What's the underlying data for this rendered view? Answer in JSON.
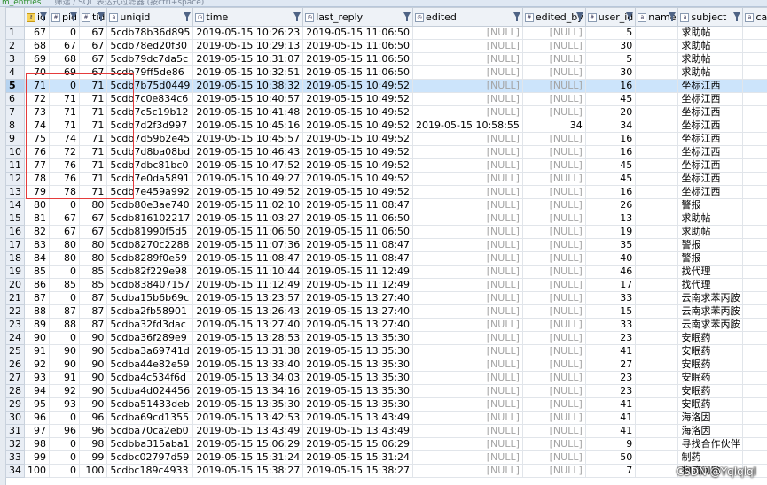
{
  "window": {
    "tab_label": "m_entries",
    "hint": "筛选 / SQL 表达式过滤器 (按ctrl+space)"
  },
  "columns": [
    {
      "label": "id",
      "icon": "key-icon"
    },
    {
      "label": "pid",
      "icon": "number-icon"
    },
    {
      "label": "tid",
      "icon": "number-icon"
    },
    {
      "label": "uniqid",
      "icon": "text-icon"
    },
    {
      "label": "time",
      "icon": "clock-icon"
    },
    {
      "label": "last_reply",
      "icon": "clock-icon"
    },
    {
      "label": "edited",
      "icon": "clock-icon"
    },
    {
      "label": "edited_by",
      "icon": "number-icon"
    },
    {
      "label": "user_id",
      "icon": "number-icon"
    },
    {
      "label": "name",
      "icon": "text-icon"
    },
    {
      "label": "subject",
      "icon": "text-icon"
    },
    {
      "label": "category",
      "icon": "text-icon"
    }
  ],
  "rows": [
    {
      "n": "1",
      "id": "67",
      "pid": "0",
      "tid": "67",
      "uniqid": "5cdb78b36d895",
      "time": "2019-05-15 10:26:23",
      "last_reply": "2019-05-15 11:06:50",
      "edited": "[NULL]",
      "edited_by": "[NULL]",
      "user_id": "5",
      "subject": "求助帖"
    },
    {
      "n": "2",
      "id": "68",
      "pid": "67",
      "tid": "67",
      "uniqid": "5cdb78ed20f30",
      "time": "2019-05-15 10:29:13",
      "last_reply": "2019-05-15 11:06:50",
      "edited": "[NULL]",
      "edited_by": "[NULL]",
      "user_id": "30",
      "subject": "求助帖"
    },
    {
      "n": "3",
      "id": "69",
      "pid": "68",
      "tid": "67",
      "uniqid": "5cdb79dc7da5c",
      "time": "2019-05-15 10:31:07",
      "last_reply": "2019-05-15 11:06:50",
      "edited": "[NULL]",
      "edited_by": "[NULL]",
      "user_id": "5",
      "subject": "求助帖"
    },
    {
      "n": "4",
      "id": "70",
      "pid": "69",
      "tid": "67",
      "uniqid": "5cdb79ff5de86",
      "time": "2019-05-15 10:32:51",
      "last_reply": "2019-05-15 11:06:50",
      "edited": "[NULL]",
      "edited_by": "[NULL]",
      "user_id": "30",
      "subject": "求助帖"
    },
    {
      "n": "5",
      "id": "71",
      "pid": "0",
      "tid": "71",
      "uniqid": "5cdb7b75d0449",
      "time": "2019-05-15 10:38:32",
      "last_reply": "2019-05-15 10:49:52",
      "edited": "[NULL]",
      "edited_by": "[NULL]",
      "user_id": "16",
      "subject": "坐标江西",
      "selected": true
    },
    {
      "n": "6",
      "id": "72",
      "pid": "71",
      "tid": "71",
      "uniqid": "5cdb7c0e834c6",
      "time": "2019-05-15 10:40:57",
      "last_reply": "2019-05-15 10:49:52",
      "edited": "[NULL]",
      "edited_by": "[NULL]",
      "user_id": "45",
      "subject": "坐标江西"
    },
    {
      "n": "7",
      "id": "73",
      "pid": "71",
      "tid": "71",
      "uniqid": "5cdb7c5c19b12",
      "time": "2019-05-15 10:41:48",
      "last_reply": "2019-05-15 10:49:52",
      "edited": "[NULL]",
      "edited_by": "[NULL]",
      "user_id": "20",
      "subject": "坐标江西"
    },
    {
      "n": "8",
      "id": "74",
      "pid": "71",
      "tid": "71",
      "uniqid": "5cdb7d2f3d997",
      "time": "2019-05-15 10:45:16",
      "last_reply": "2019-05-15 10:49:52",
      "edited": "2019-05-15 10:58:55",
      "edited_by": "34",
      "user_id": "34",
      "subject": "坐标江西"
    },
    {
      "n": "9",
      "id": "75",
      "pid": "74",
      "tid": "71",
      "uniqid": "5cdb7d59b2e45",
      "time": "2019-05-15 10:45:57",
      "last_reply": "2019-05-15 10:49:52",
      "edited": "[NULL]",
      "edited_by": "[NULL]",
      "user_id": "16",
      "subject": "坐标江西"
    },
    {
      "n": "10",
      "id": "76",
      "pid": "72",
      "tid": "71",
      "uniqid": "5cdb7d8ba08bd",
      "time": "2019-05-15 10:46:43",
      "last_reply": "2019-05-15 10:49:52",
      "edited": "[NULL]",
      "edited_by": "[NULL]",
      "user_id": "16",
      "subject": "坐标江西"
    },
    {
      "n": "11",
      "id": "77",
      "pid": "76",
      "tid": "71",
      "uniqid": "5cdb7dbc81bc0",
      "time": "2019-05-15 10:47:52",
      "last_reply": "2019-05-15 10:49:52",
      "edited": "[NULL]",
      "edited_by": "[NULL]",
      "user_id": "45",
      "subject": "坐标江西"
    },
    {
      "n": "12",
      "id": "78",
      "pid": "76",
      "tid": "71",
      "uniqid": "5cdb7e0da5891",
      "time": "2019-05-15 10:49:27",
      "last_reply": "2019-05-15 10:49:52",
      "edited": "[NULL]",
      "edited_by": "[NULL]",
      "user_id": "45",
      "subject": "坐标江西"
    },
    {
      "n": "13",
      "id": "79",
      "pid": "78",
      "tid": "71",
      "uniqid": "5cdb7e459a992",
      "time": "2019-05-15 10:49:52",
      "last_reply": "2019-05-15 10:49:52",
      "edited": "[NULL]",
      "edited_by": "[NULL]",
      "user_id": "16",
      "subject": "坐标江西"
    },
    {
      "n": "14",
      "id": "80",
      "pid": "0",
      "tid": "80",
      "uniqid": "5cdb80e3ae740",
      "time": "2019-05-15 11:02:10",
      "last_reply": "2019-05-15 11:08:47",
      "edited": "[NULL]",
      "edited_by": "[NULL]",
      "user_id": "26",
      "subject": "警报"
    },
    {
      "n": "15",
      "id": "81",
      "pid": "67",
      "tid": "67",
      "uniqid": "5cdb816102217",
      "time": "2019-05-15 11:03:27",
      "last_reply": "2019-05-15 11:06:50",
      "edited": "[NULL]",
      "edited_by": "[NULL]",
      "user_id": "13",
      "subject": "求助帖"
    },
    {
      "n": "16",
      "id": "82",
      "pid": "67",
      "tid": "67",
      "uniqid": "5cdb81990f5d5",
      "time": "2019-05-15 11:06:50",
      "last_reply": "2019-05-15 11:06:50",
      "edited": "[NULL]",
      "edited_by": "[NULL]",
      "user_id": "19",
      "subject": "求助帖"
    },
    {
      "n": "17",
      "id": "83",
      "pid": "80",
      "tid": "80",
      "uniqid": "5cdb8270c2288",
      "time": "2019-05-15 11:07:36",
      "last_reply": "2019-05-15 11:08:47",
      "edited": "[NULL]",
      "edited_by": "[NULL]",
      "user_id": "35",
      "subject": "警报"
    },
    {
      "n": "18",
      "id": "84",
      "pid": "80",
      "tid": "80",
      "uniqid": "5cdb8289f0e59",
      "time": "2019-05-15 11:08:47",
      "last_reply": "2019-05-15 11:08:47",
      "edited": "[NULL]",
      "edited_by": "[NULL]",
      "user_id": "40",
      "subject": "警报"
    },
    {
      "n": "19",
      "id": "85",
      "pid": "0",
      "tid": "85",
      "uniqid": "5cdb82f229e98",
      "time": "2019-05-15 11:10:44",
      "last_reply": "2019-05-15 11:12:49",
      "edited": "[NULL]",
      "edited_by": "[NULL]",
      "user_id": "46",
      "subject": "找代理"
    },
    {
      "n": "20",
      "id": "86",
      "pid": "85",
      "tid": "85",
      "uniqid": "5cdb838407157",
      "time": "2019-05-15 11:12:49",
      "last_reply": "2019-05-15 11:12:49",
      "edited": "[NULL]",
      "edited_by": "[NULL]",
      "user_id": "17",
      "subject": "找代理"
    },
    {
      "n": "21",
      "id": "87",
      "pid": "0",
      "tid": "87",
      "uniqid": "5cdba15b6b69c",
      "time": "2019-05-15 13:23:57",
      "last_reply": "2019-05-15 13:27:40",
      "edited": "[NULL]",
      "edited_by": "[NULL]",
      "user_id": "33",
      "subject": "云南求苯丙胺"
    },
    {
      "n": "22",
      "id": "88",
      "pid": "87",
      "tid": "87",
      "uniqid": "5cdba2fb58901",
      "time": "2019-05-15 13:26:43",
      "last_reply": "2019-05-15 13:27:40",
      "edited": "[NULL]",
      "edited_by": "[NULL]",
      "user_id": "15",
      "subject": "云南求苯丙胺"
    },
    {
      "n": "23",
      "id": "89",
      "pid": "88",
      "tid": "87",
      "uniqid": "5cdba32fd3dac",
      "time": "2019-05-15 13:27:40",
      "last_reply": "2019-05-15 13:27:40",
      "edited": "[NULL]",
      "edited_by": "[NULL]",
      "user_id": "33",
      "subject": "云南求苯丙胺"
    },
    {
      "n": "24",
      "id": "90",
      "pid": "0",
      "tid": "90",
      "uniqid": "5cdba36f289e9",
      "time": "2019-05-15 13:28:53",
      "last_reply": "2019-05-15 13:35:30",
      "edited": "[NULL]",
      "edited_by": "[NULL]",
      "user_id": "23",
      "subject": "安眠药"
    },
    {
      "n": "25",
      "id": "91",
      "pid": "90",
      "tid": "90",
      "uniqid": "5cdba3a69741d",
      "time": "2019-05-15 13:31:38",
      "last_reply": "2019-05-15 13:35:30",
      "edited": "[NULL]",
      "edited_by": "[NULL]",
      "user_id": "41",
      "subject": "安眠药"
    },
    {
      "n": "26",
      "id": "92",
      "pid": "90",
      "tid": "90",
      "uniqid": "5cdba44e82e59",
      "time": "2019-05-15 13:33:40",
      "last_reply": "2019-05-15 13:35:30",
      "edited": "[NULL]",
      "edited_by": "[NULL]",
      "user_id": "27",
      "subject": "安眠药"
    },
    {
      "n": "27",
      "id": "93",
      "pid": "91",
      "tid": "90",
      "uniqid": "5cdba4c534f6d",
      "time": "2019-05-15 13:34:03",
      "last_reply": "2019-05-15 13:35:30",
      "edited": "[NULL]",
      "edited_by": "[NULL]",
      "user_id": "23",
      "subject": "安眠药"
    },
    {
      "n": "28",
      "id": "94",
      "pid": "92",
      "tid": "90",
      "uniqid": "5cdba4d024456",
      "time": "2019-05-15 13:34:16",
      "last_reply": "2019-05-15 13:35:30",
      "edited": "[NULL]",
      "edited_by": "[NULL]",
      "user_id": "23",
      "subject": "安眠药"
    },
    {
      "n": "29",
      "id": "95",
      "pid": "93",
      "tid": "90",
      "uniqid": "5cdba51433deb",
      "time": "2019-05-15 13:35:30",
      "last_reply": "2019-05-15 13:35:30",
      "edited": "[NULL]",
      "edited_by": "[NULL]",
      "user_id": "41",
      "subject": "安眠药"
    },
    {
      "n": "30",
      "id": "96",
      "pid": "0",
      "tid": "96",
      "uniqid": "5cdba69cd1355",
      "time": "2019-05-15 13:42:53",
      "last_reply": "2019-05-15 13:43:49",
      "edited": "[NULL]",
      "edited_by": "[NULL]",
      "user_id": "41",
      "subject": "海洛因"
    },
    {
      "n": "31",
      "id": "97",
      "pid": "96",
      "tid": "96",
      "uniqid": "5cdba70ca2eb0",
      "time": "2019-05-15 13:43:49",
      "last_reply": "2019-05-15 13:43:49",
      "edited": "[NULL]",
      "edited_by": "[NULL]",
      "user_id": "41",
      "subject": "海洛因"
    },
    {
      "n": "32",
      "id": "98",
      "pid": "0",
      "tid": "98",
      "uniqid": "5cdbba315aba1",
      "time": "2019-05-15 15:06:29",
      "last_reply": "2019-05-15 15:06:29",
      "edited": "[NULL]",
      "edited_by": "[NULL]",
      "user_id": "9",
      "subject": "寻找合作伙伴"
    },
    {
      "n": "33",
      "id": "99",
      "pid": "0",
      "tid": "99",
      "uniqid": "5cdbc02797d59",
      "time": "2019-05-15 15:31:24",
      "last_reply": "2019-05-15 15:31:24",
      "edited": "[NULL]",
      "edited_by": "[NULL]",
      "user_id": "50",
      "subject": "制药"
    },
    {
      "n": "34",
      "id": "100",
      "pid": "0",
      "tid": "100",
      "uniqid": "5cdbc189c4933",
      "time": "2019-05-15 15:38:27",
      "last_reply": "2019-05-15 15:38:27",
      "edited": "[NULL]",
      "edited_by": "[NULL]",
      "user_id": "7",
      "subject": "物流问题"
    }
  ],
  "watermark": "CSDN @Yqlqlql",
  "colors": {
    "selection": "#cce4fb",
    "highlight_box": "#e53b3b",
    "null_text": "#a4a4a4"
  }
}
